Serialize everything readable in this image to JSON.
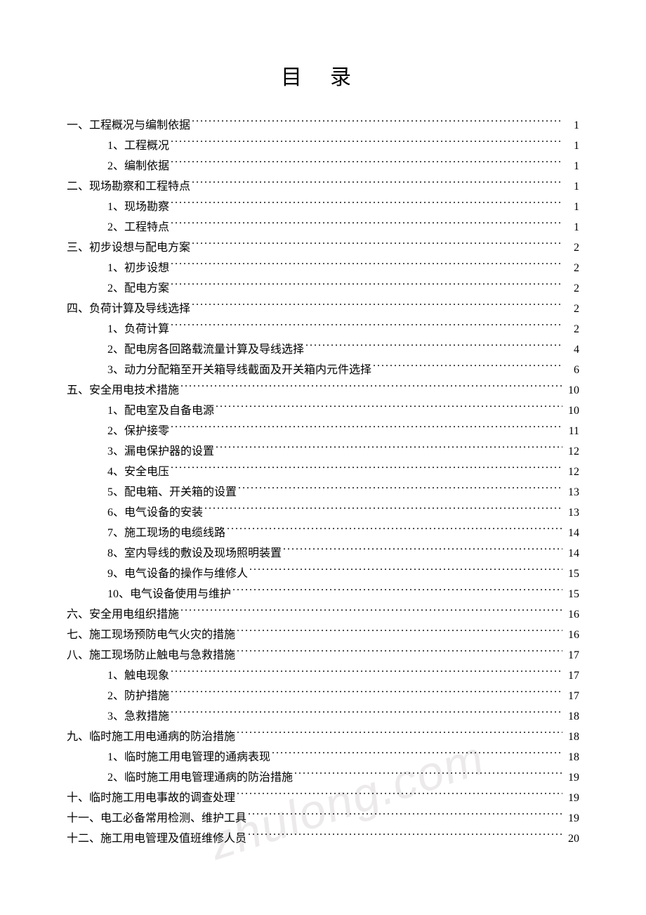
{
  "title": "目录",
  "watermark": "zhulong.com",
  "toc": [
    {
      "level": 1,
      "label": "一、工程概况与编制依据",
      "page": "1"
    },
    {
      "level": 2,
      "label": "1、工程概况",
      "page": "1"
    },
    {
      "level": 2,
      "label": "2、编制依据",
      "page": "1"
    },
    {
      "level": 1,
      "label": "二、现场勘察和工程特点",
      "page": "1"
    },
    {
      "level": 2,
      "label": "1、现场勘察",
      "page": "1"
    },
    {
      "level": 2,
      "label": "2、工程特点",
      "page": "1"
    },
    {
      "level": 1,
      "label": "三、初步设想与配电方案",
      "page": "2"
    },
    {
      "level": 2,
      "label": "1、初步设想",
      "page": "2"
    },
    {
      "level": 2,
      "label": "2、配电方案",
      "page": "2"
    },
    {
      "level": 1,
      "label": "四、负荷计算及导线选择",
      "page": "2"
    },
    {
      "level": 2,
      "label": "1、负荷计算",
      "page": "2"
    },
    {
      "level": 2,
      "label": "2、配电房各回路载流量计算及导线选择",
      "page": "4"
    },
    {
      "level": 2,
      "label": "3、动力分配箱至开关箱导线截面及开关箱内元件选择",
      "page": "6"
    },
    {
      "level": 1,
      "label": "五、安全用电技术措施",
      "page": "10"
    },
    {
      "level": 2,
      "label": "1、配电室及自备电源",
      "page": "10"
    },
    {
      "level": 2,
      "label": "2、保护接零",
      "page": "11"
    },
    {
      "level": 2,
      "label": "3、漏电保护器的设置",
      "page": "12"
    },
    {
      "level": 2,
      "label": "4、安全电压",
      "page": "12"
    },
    {
      "level": 2,
      "label": "5、配电箱、开关箱的设置",
      "page": "13"
    },
    {
      "level": 2,
      "label": "6、电气设备的安装",
      "page": "13"
    },
    {
      "level": 2,
      "label": "7、施工现场的电缆线路",
      "page": "14"
    },
    {
      "level": 2,
      "label": "8、室内导线的敷设及现场照明装置",
      "page": "14"
    },
    {
      "level": 2,
      "label": "9、电气设备的操作与维修人",
      "page": "15"
    },
    {
      "level": 2,
      "label": "10、电气设备使用与维护",
      "page": "15"
    },
    {
      "level": 1,
      "label": "六、安全用电组织措施",
      "page": "16"
    },
    {
      "level": 1,
      "label": "七、施工现场预防电气火灾的措施",
      "page": "16"
    },
    {
      "level": 1,
      "label": "八、施工现场防止触电与急救措施",
      "page": "17"
    },
    {
      "level": 2,
      "label": "1、触电现象",
      "page": "17"
    },
    {
      "level": 2,
      "label": "2、防护措施",
      "page": "17"
    },
    {
      "level": 2,
      "label": "3、急救措施",
      "page": "18"
    },
    {
      "level": 1,
      "label": "九、临时施工用电通病的防治措施",
      "page": "18"
    },
    {
      "level": 2,
      "label": "1、临时施工用电管理的通病表现",
      "page": "18"
    },
    {
      "level": 2,
      "label": "2、临时施工用电管理通病的防治措施",
      "page": "19"
    },
    {
      "level": 1,
      "label": "十、临时施工用电事故的调查处理",
      "page": "19"
    },
    {
      "level": 1,
      "label": "十一、电工必备常用检测、维护工具",
      "page": "19"
    },
    {
      "level": 1,
      "label": "十二、施工用电管理及值班维修人员",
      "page": "20"
    }
  ]
}
